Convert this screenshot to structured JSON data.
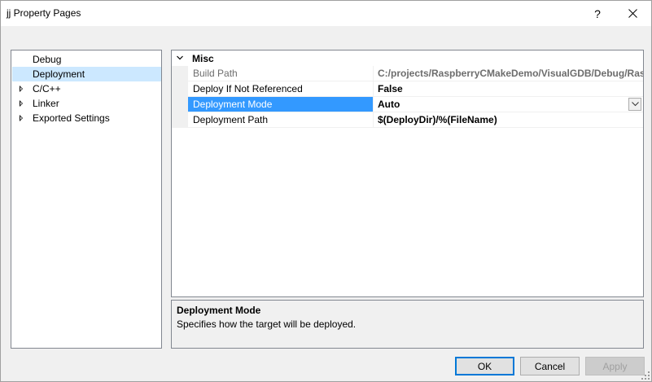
{
  "window": {
    "title": "jj Property Pages",
    "help_glyph": "?",
    "close_glyph": "✕"
  },
  "tree": {
    "items": [
      {
        "label": "Debug",
        "expandable": false,
        "selected": false
      },
      {
        "label": "Deployment",
        "expandable": false,
        "selected": true
      },
      {
        "label": "C/C++",
        "expandable": true,
        "selected": false
      },
      {
        "label": "Linker",
        "expandable": true,
        "selected": false
      },
      {
        "label": "Exported Settings",
        "expandable": true,
        "selected": false
      }
    ]
  },
  "grid": {
    "category": "Misc",
    "properties": [
      {
        "name": "Build Path",
        "value": "C:/projects/RaspberryCMakeDemo/VisualGDB/Debug/Rasp",
        "state": "disabled"
      },
      {
        "name": "Deploy If Not Referenced",
        "value": "False",
        "state": "normal"
      },
      {
        "name": "Deployment Mode",
        "value": "Auto",
        "state": "selected"
      },
      {
        "name": "Deployment Path",
        "value": "$(DeployDir)/%(FileName)",
        "state": "normal"
      }
    ]
  },
  "description": {
    "title": "Deployment Mode",
    "text": "Specifies how the target will be deployed."
  },
  "buttons": {
    "ok": "OK",
    "cancel": "Cancel",
    "apply": "Apply"
  },
  "colors": {
    "selection": "#3399ff",
    "tree_selection": "#cce8ff",
    "default_button_border": "#0078d7"
  }
}
